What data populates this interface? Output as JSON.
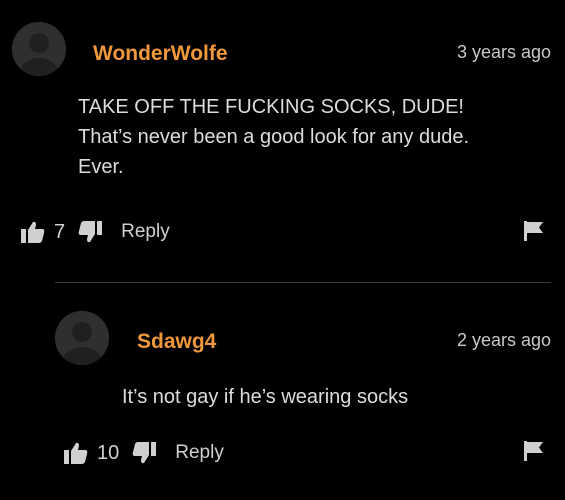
{
  "comments": [
    {
      "username": "WonderWolfe",
      "timestamp": "3 years ago",
      "body_lines": [
        "TAKE OFF THE FUCKING SOCKS, DUDE!",
        "That’s never been a good look for any dude.",
        "Ever."
      ],
      "likes": "7",
      "reply_label": "Reply"
    },
    {
      "username": "Sdawg4",
      "timestamp": "2 years ago",
      "body_lines": [
        "It’s not gay if he’s wearing socks"
      ],
      "likes": "10",
      "reply_label": "Reply"
    }
  ],
  "colors": {
    "background": "#000000",
    "username": "#f0983c",
    "text": "#dcdcdc",
    "avatar": "#333333"
  },
  "icons": [
    "avatar-silhouette-icon",
    "thumbs-up-icon",
    "thumbs-down-icon",
    "flag-icon"
  ]
}
